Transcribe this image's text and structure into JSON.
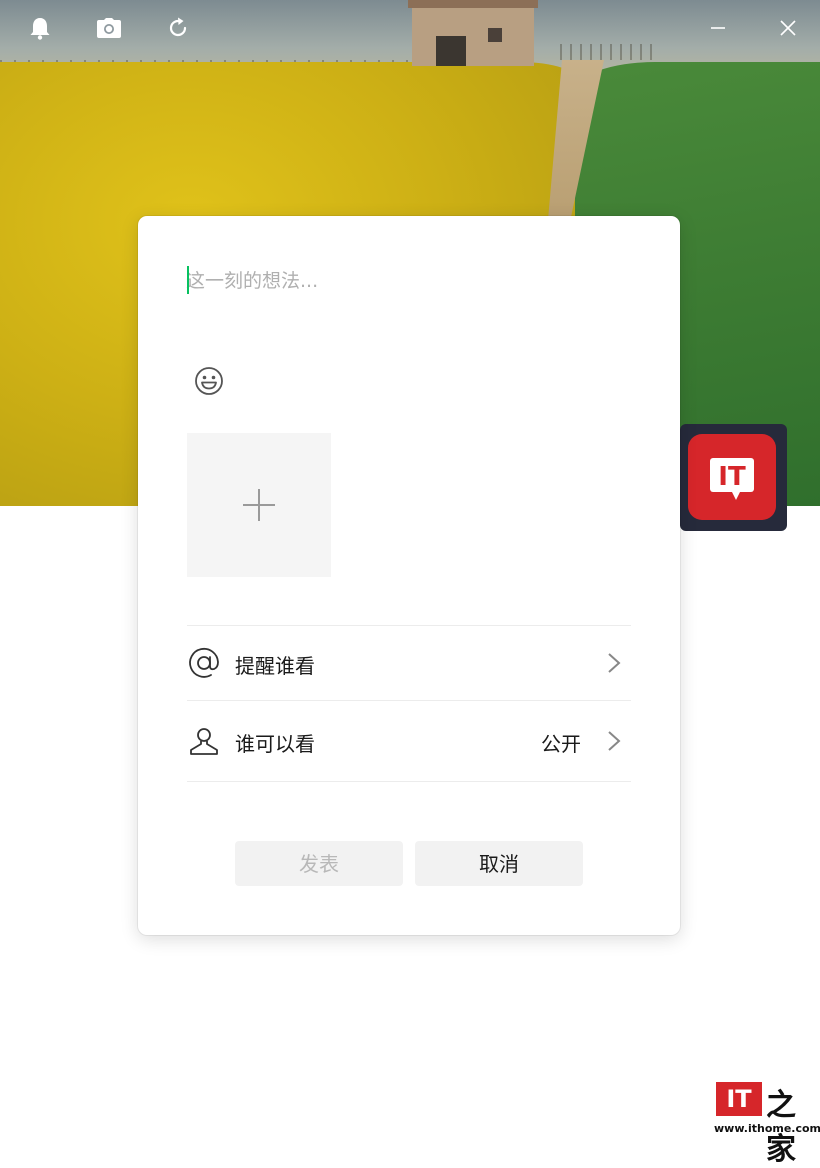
{
  "toolbar": {
    "icons": [
      "bell-icon",
      "camera-icon",
      "refresh-icon"
    ],
    "window_controls": [
      "minimize-icon",
      "close-icon"
    ]
  },
  "composer": {
    "placeholder": "这一刻的想法...",
    "emoji_icon": "smile-icon",
    "add_photo_icon": "plus-icon",
    "rows": [
      {
        "icon": "at-icon",
        "label": "提醒谁看",
        "value": ""
      },
      {
        "icon": "person-icon",
        "label": "谁可以看",
        "value": "公开"
      }
    ],
    "post_label": "发表",
    "cancel_label": "取消"
  },
  "avatar": {
    "text": "IT"
  },
  "watermark": {
    "logo": "IT",
    "brand": "之家",
    "url": "www.ithome.com"
  },
  "colors": {
    "accent": "#07c160",
    "brand_red": "#d6262a",
    "button_bg": "#f2f2f2",
    "disabled_text": "#b8b8b8"
  }
}
